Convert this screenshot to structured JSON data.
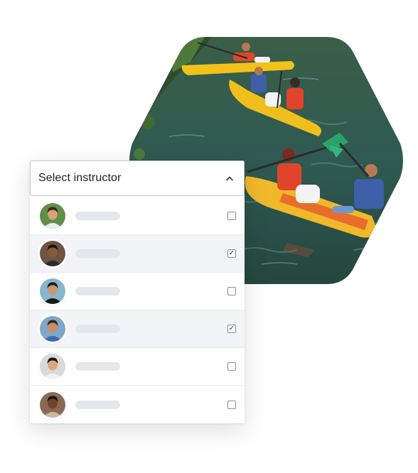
{
  "dropdown": {
    "title": "Select instructor",
    "expanded": true,
    "chevron_icon": "chevron-up-icon"
  },
  "instructors": [
    {
      "avatar_bg": "#5f8f4a",
      "skin": "#d9a27a",
      "hair": "#3b2618",
      "shirt": "#e9eef2",
      "checked": false,
      "check_glyph": ""
    },
    {
      "avatar_bg": "#6d5442",
      "skin": "#8a5a3c",
      "hair": "#1e1410",
      "shirt": "#2b2b2b",
      "checked": true,
      "check_glyph": "✓"
    },
    {
      "avatar_bg": "#87b6cf",
      "skin": "#c89873",
      "hair": "#1c1c1c",
      "shirt": "#1a1a1a",
      "checked": false,
      "check_glyph": ""
    },
    {
      "avatar_bg": "#7fa7c9",
      "skin": "#c48f6a",
      "hair": "#3a2a1e",
      "shirt": "#3a6db0",
      "checked": true,
      "check_glyph": "✓"
    },
    {
      "avatar_bg": "#d9d9d9",
      "skin": "#d7a883",
      "hair": "#1b120e",
      "shirt": "#f2f2f2",
      "checked": false,
      "check_glyph": ""
    },
    {
      "avatar_bg": "#8a6a55",
      "skin": "#6e4630",
      "hair": "#1c130d",
      "shirt": "#d0b89a",
      "checked": false,
      "check_glyph": ""
    }
  ],
  "photo": {
    "subject": "kayakers-on-river",
    "water_color": "#2f5a4a",
    "kayak_color": "#f2c21a",
    "life_vest_color": "#e0452b"
  }
}
